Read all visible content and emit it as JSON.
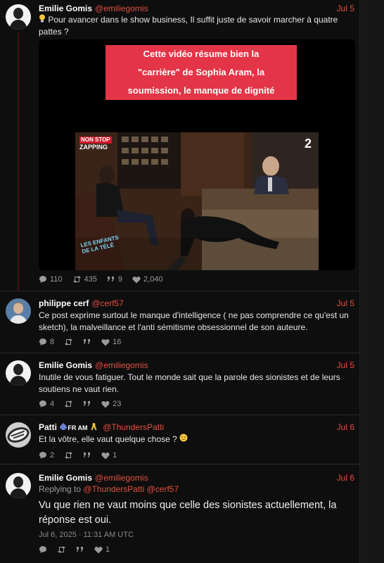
{
  "posts": [
    {
      "author": "Emilie Gomis",
      "handle": "@emiliegomis",
      "date": "Jul 5",
      "text": "Pour avancer dans le show business, Il suffit juste de savoir marcher à quatre pattes ?",
      "icon": "lightbulb-icon",
      "media": {
        "caption": [
          "Cette vidéo résume bien la",
          "\"carrière\" de Sophia Aram, la",
          "soumission, le manque de dignité"
        ],
        "logo_top": "NON STOP",
        "logo_bottom": "ZAPPING",
        "channel_number": "2",
        "watermark": "LES ENFANTS DE LA TÉLÉ"
      },
      "stats": {
        "replies": "110",
        "reposts": "435",
        "quotes": "9",
        "likes": "2,040"
      }
    },
    {
      "author": "philippe cerf",
      "handle": "@cerf57",
      "date": "Jul 5",
      "text": "Ce post exprime surtout le manque d'intelligence ( ne pas comprendre ce qu'est un sketch), la malveillance et l'anti sémitisme obsessionnel de son auteure.",
      "stats": {
        "replies": "8",
        "reposts": "",
        "quotes": "",
        "likes": "16"
      }
    },
    {
      "author": "Emilie Gomis",
      "handle": "@emiliegomis",
      "date": "Jul 5",
      "text": "Inutile de vous fatiguer. Tout le monde sait que la parole des sionistes et de leurs soutiens ne vaut rien.",
      "stats": {
        "replies": "4",
        "reposts": "",
        "quotes": "",
        "likes": "23"
      }
    },
    {
      "author": "Patti",
      "author_suffix": "FR AM",
      "handle": "@ThundersPatti",
      "date": "Jul 6",
      "text": "Et la vôtre, elle vaut quelque chose ?",
      "stats": {
        "replies": "2",
        "reposts": "",
        "quotes": "",
        "likes": "1"
      }
    },
    {
      "author": "Emilie Gomis",
      "handle": "@emiliegomis",
      "date": "Jul 6",
      "replying_prefix": "Replying to",
      "replying_to": "@ThundersPatti @cerf57",
      "text": "Vu que rien ne vaut moins que celle des sionistes actuellement, la réponse est oui.",
      "timestamp": "Jul 6, 2025 · 11:31 AM UTC",
      "stats": {
        "replies": "",
        "reposts": "",
        "quotes": "",
        "likes": "1"
      }
    }
  ],
  "colors": {
    "accent": "#e0503f",
    "background": "#0e0e0e",
    "caption_bg": "#e33547"
  }
}
